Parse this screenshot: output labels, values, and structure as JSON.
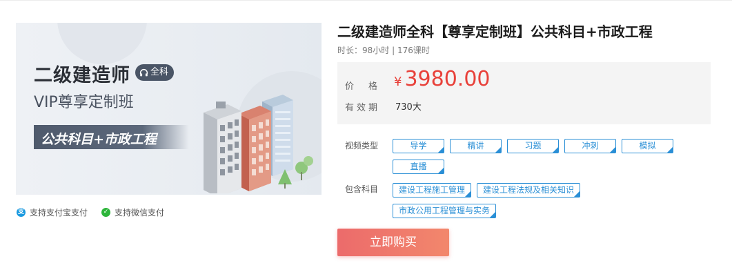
{
  "banner": {
    "title": "二级建造师",
    "badge": "全科",
    "subtitle": "VIP尊享定制班",
    "tagline": "公共科目+市政工程"
  },
  "payment": {
    "alipay": "支持支付宝支付",
    "wechat": "支持微信支付"
  },
  "product": {
    "title": "二级建造师全科【尊享定制班】公共科目+市政工程",
    "meta": "时长：98小时 | 176课时",
    "price_label": "价　格",
    "currency": "¥",
    "price": "3980.00",
    "validity_label": "有效期",
    "validity": "730大"
  },
  "options": {
    "video_type_label": "视频类型",
    "video_types": [
      "导学",
      "精讲",
      "习题",
      "冲刺",
      "模拟",
      "直播"
    ],
    "subjects_label": "包含科目",
    "subjects": [
      "建设工程施工管理",
      "建设工程法规及相关知识",
      "市政公用工程管理与实务"
    ]
  },
  "buy_button": "立即购买",
  "colors": {
    "accent_blue": "#2a8fd6",
    "price_red": "#e8413a",
    "buy_gradient_start": "#ec6b6b",
    "buy_gradient_end": "#f2876c"
  }
}
